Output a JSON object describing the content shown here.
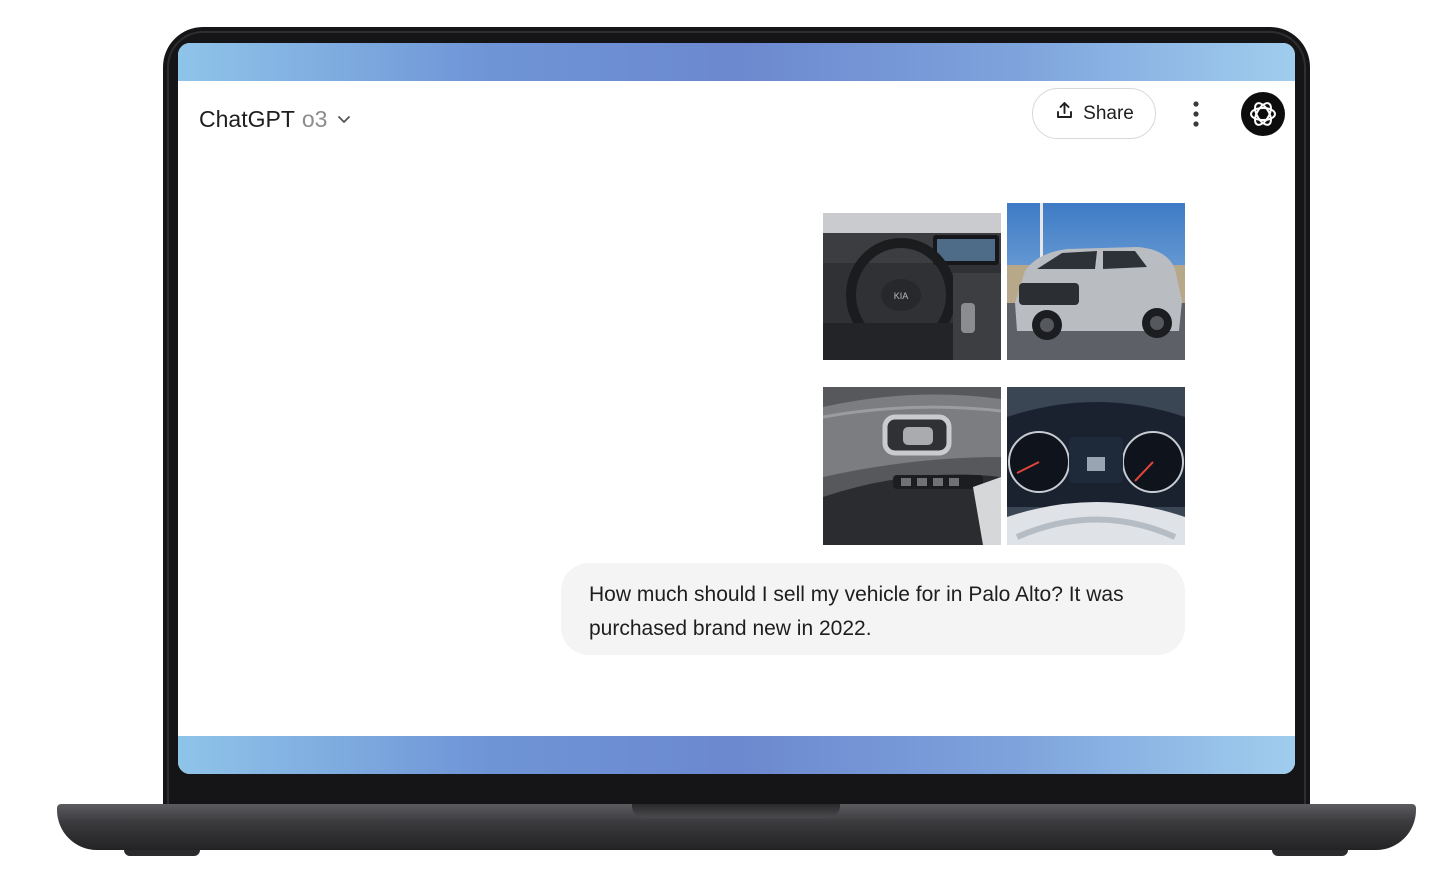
{
  "header": {
    "app_name": "ChatGPT",
    "model": "o3",
    "share_label": "Share"
  },
  "icons": {
    "model_dropdown": "chevron-down-icon",
    "share": "share-upload-icon",
    "more": "more-vertical-icon",
    "avatar": "openai-logo-icon"
  },
  "message": {
    "text": "How much should I sell my vehicle for in Palo Alto? It was purchased brand new in 2022.",
    "attachments": [
      "car-interior-steering-wheel-photo",
      "car-exterior-suv-photo",
      "car-door-panel-photo",
      "car-instrument-cluster-photo"
    ]
  },
  "colors": {
    "accent_band": "#7090d4",
    "bubble_bg": "#f4f4f5",
    "laptop_body": "#151517"
  }
}
